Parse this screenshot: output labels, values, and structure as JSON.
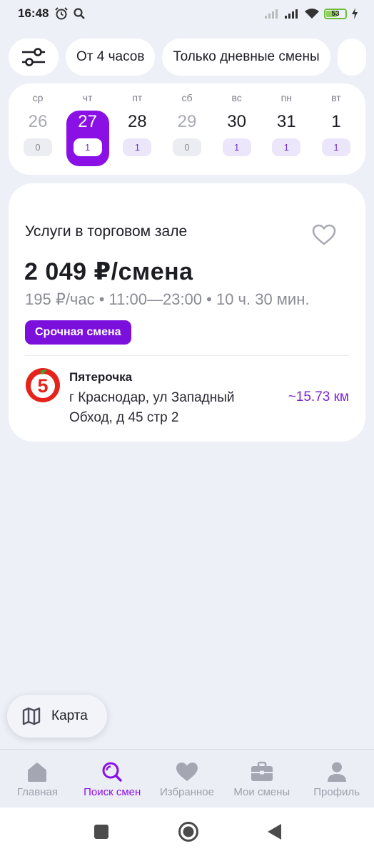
{
  "status_bar": {
    "time": "16:48",
    "battery": "53"
  },
  "filters": {
    "chips": [
      "От 4 часов",
      "Только дневные смены"
    ]
  },
  "calendar": {
    "days": [
      {
        "dow": "ср",
        "date": "26",
        "count": "0",
        "state": "muted"
      },
      {
        "dow": "чт",
        "date": "27",
        "count": "1",
        "state": "selected"
      },
      {
        "dow": "пт",
        "date": "28",
        "count": "1",
        "state": "normal"
      },
      {
        "dow": "сб",
        "date": "29",
        "count": "0",
        "state": "muted"
      },
      {
        "dow": "вс",
        "date": "30",
        "count": "1",
        "state": "normal"
      },
      {
        "dow": "пн",
        "date": "31",
        "count": "1",
        "state": "normal"
      },
      {
        "dow": "вт",
        "date": "1",
        "count": "1",
        "state": "normal"
      }
    ]
  },
  "shift_card": {
    "title": "Услуги в торговом зале",
    "price": "2 049 ₽/смена",
    "details": "195 ₽/час • 11:00—23:00 • 10 ч. 30 мин.",
    "urgent_label": "Срочная смена",
    "store_name": "Пятерочка",
    "address": "г Краснодар, ул Западный Обход, д 45 стр 2",
    "distance": "~15.73 км"
  },
  "map_button": {
    "label": "Карта"
  },
  "tabbar": {
    "tabs": [
      {
        "label": "Главная",
        "icon": "home-icon"
      },
      {
        "label": "Поиск смен",
        "icon": "search-icon",
        "active": true
      },
      {
        "label": "Избранное",
        "icon": "heart-icon"
      },
      {
        "label": "Мои смены",
        "icon": "briefcase-icon"
      },
      {
        "label": "Профиль",
        "icon": "profile-icon"
      }
    ]
  },
  "colors": {
    "accent": "#8a10e6",
    "background": "#eef0f8",
    "tab_inactive": "#9ea0ab"
  }
}
